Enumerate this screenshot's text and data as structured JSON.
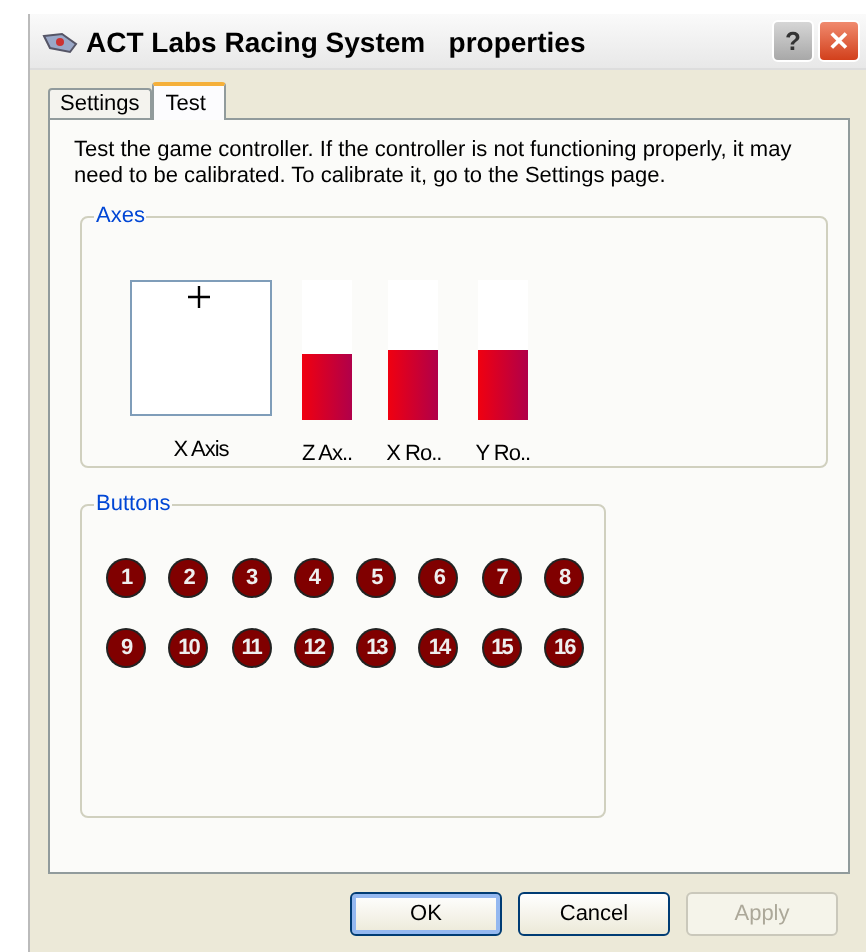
{
  "window": {
    "title": "ACT Labs Racing System   properties",
    "help": "?",
    "close": "✕"
  },
  "tabs": [
    {
      "label": "Settings",
      "selected": false
    },
    {
      "label": "Test",
      "selected": true
    }
  ],
  "description": "Test the game controller.  If the controller is not functioning properly, it may need to be calibrated.  To calibrate it, go to the Settings page.",
  "axes": {
    "title": "Axes",
    "xy_label": "X Axis",
    "bars": [
      {
        "label": "Z Ax..",
        "level": 0.47
      },
      {
        "label": "X Ro..",
        "level": 0.5
      },
      {
        "label": "Y Ro..",
        "level": 0.5
      }
    ]
  },
  "buttons_group": {
    "title": "Buttons",
    "buttons": [
      {
        "label": "1",
        "pressed": false
      },
      {
        "label": "2",
        "pressed": false
      },
      {
        "label": "3",
        "pressed": false
      },
      {
        "label": "4",
        "pressed": false
      },
      {
        "label": "5",
        "pressed": false
      },
      {
        "label": "6",
        "pressed": false
      },
      {
        "label": "7",
        "pressed": false
      },
      {
        "label": "8",
        "pressed": false
      },
      {
        "label": "9",
        "pressed": false
      },
      {
        "label": "10",
        "pressed": false
      },
      {
        "label": "11",
        "pressed": false
      },
      {
        "label": "12",
        "pressed": false
      },
      {
        "label": "13",
        "pressed": false
      },
      {
        "label": "14",
        "pressed": false
      },
      {
        "label": "15",
        "pressed": false
      },
      {
        "label": "16",
        "pressed": false
      }
    ]
  },
  "dialog_buttons": [
    {
      "label": "OK",
      "disabled": false
    },
    {
      "label": "Cancel",
      "disabled": false
    },
    {
      "label": "Apply",
      "disabled": true
    }
  ]
}
